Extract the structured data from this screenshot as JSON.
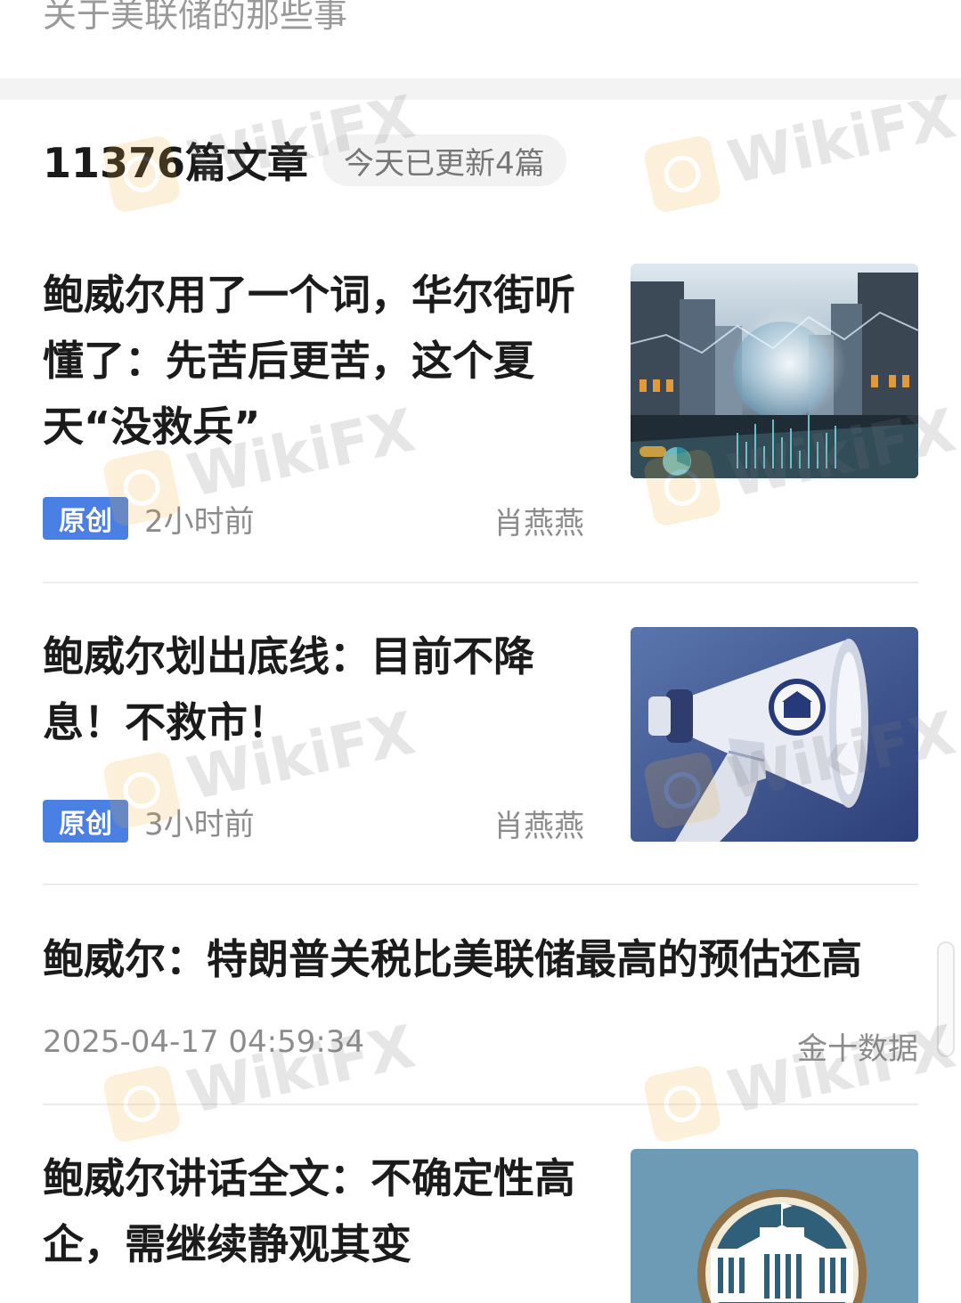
{
  "header": {
    "description": "关于美联储的那些事"
  },
  "summary": {
    "article_count": "11376篇文章",
    "today_update": "今天已更新4篇"
  },
  "articles": [
    {
      "title": "鲍威尔用了一个词，华尔街听懂了：先苦后更苦，这个夏天“没救兵”",
      "badge": "原创",
      "time": "2小时前",
      "author": "肖燕燕"
    },
    {
      "title": "鲍威尔划出底线：目前不降息！不救市！",
      "badge": "原创",
      "time": "3小时前",
      "author": "肖燕燕"
    },
    {
      "title": "鲍威尔：特朗普关税比美联储最高的预估还高",
      "time": "2025-04-17 04:59:34",
      "author": "金十数据"
    },
    {
      "title": "鲍威尔讲话全文：不确定性高企，需继续静观其变"
    }
  ],
  "watermark": {
    "text": "WikiFX"
  },
  "colors": {
    "badge": "#4a7fe4",
    "meta_text": "#8c8c8c",
    "divider": "#ececec"
  }
}
